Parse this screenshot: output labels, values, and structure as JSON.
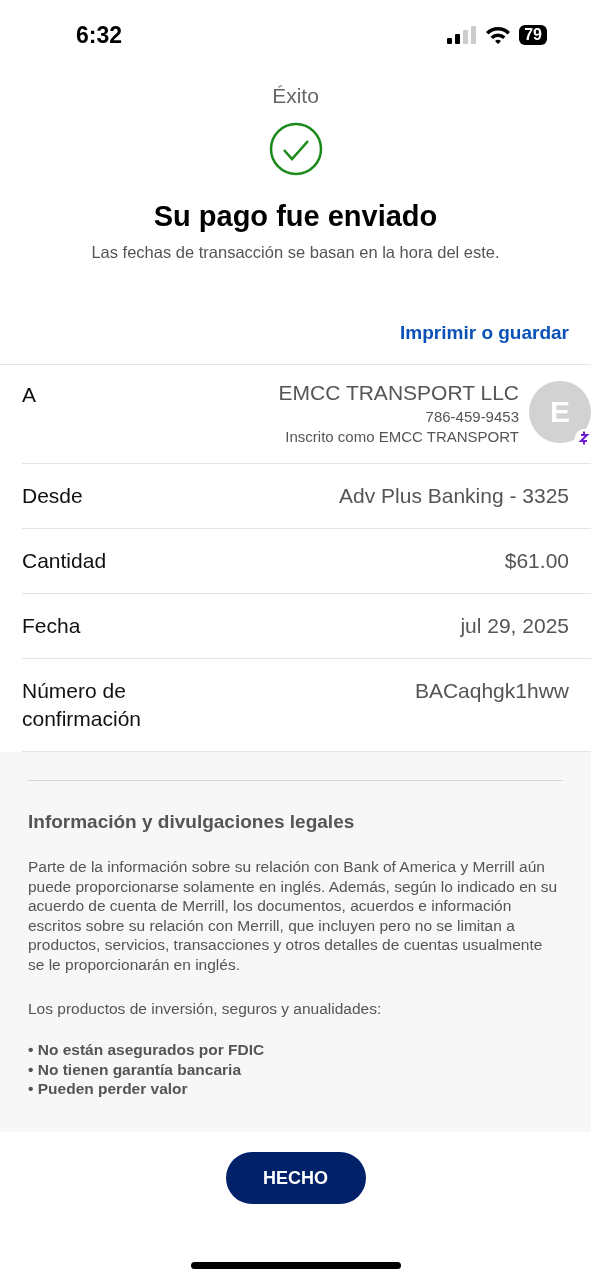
{
  "status_bar": {
    "time": "6:32",
    "battery": "79"
  },
  "header": {
    "title": "Éxito"
  },
  "confirmation": {
    "heading": "Su pago fue enviado",
    "note": "Las fechas de transacción se basan en la hora del este."
  },
  "print_link": "Imprimir o guardar",
  "details": [
    {
      "kind": "recipient",
      "label": "A",
      "name": "EMCC TRANSPORT LLC",
      "phone": "786-459-9453",
      "enrolled": "Inscrito como EMCC TRANSPORT",
      "avatar": "E"
    },
    {
      "kind": "plain",
      "label": "Desde",
      "value": "Adv Plus Banking - 3325"
    },
    {
      "kind": "plain",
      "label": "Cantidad",
      "value": "$61.00"
    },
    {
      "kind": "plain",
      "label": "Fecha",
      "value": "jul 29, 2025"
    },
    {
      "kind": "plain",
      "label": "Número de confirmación",
      "value": "BACaqhgk1hww"
    }
  ],
  "legal": {
    "heading": "Información y divulgaciones legales",
    "paragraphs": [
      "Parte de la información sobre su relación con Bank of America y Merrill aún puede proporcionarse solamente en inglés. Además, según lo indicado en su acuerdo de cuenta de Merrill, los documentos, acuerdos e información escritos sobre su relación con Merrill, que incluyen pero no se limitan a productos, servicios, transacciones y otros detalles de cuentas usualmente se le proporcionarán en inglés.",
      "Los productos de inversión, seguros y anualidades:"
    ],
    "bullets": [
      "• No están asegurados por FDIC",
      "• No tienen garantía bancaria",
      "• Pueden perder valor"
    ]
  },
  "done_button": "HECHO"
}
